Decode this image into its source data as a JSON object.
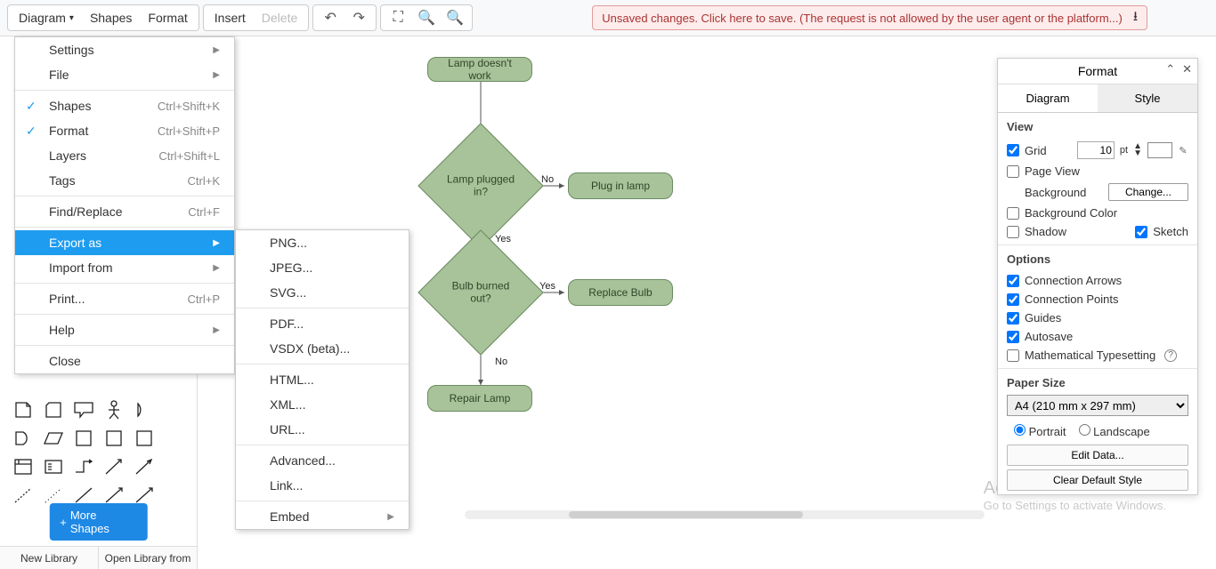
{
  "toolbar": {
    "diagram": "Diagram",
    "shapes": "Shapes",
    "format": "Format",
    "insert": "Insert",
    "delete": "Delete"
  },
  "warning": "Unsaved changes. Click here to save. (The request is not allowed by the user agent or the platform...)",
  "menu": {
    "settings": "Settings",
    "file": "File",
    "shapes": "Shapes",
    "shapes_sc": "Ctrl+Shift+K",
    "format": "Format",
    "format_sc": "Ctrl+Shift+P",
    "layers": "Layers",
    "layers_sc": "Ctrl+Shift+L",
    "tags": "Tags",
    "tags_sc": "Ctrl+K",
    "find": "Find/Replace",
    "find_sc": "Ctrl+F",
    "export": "Export as",
    "import": "Import from",
    "print": "Print...",
    "print_sc": "Ctrl+P",
    "help": "Help",
    "close": "Close"
  },
  "submenu": {
    "png": "PNG...",
    "jpeg": "JPEG...",
    "svg": "SVG...",
    "pdf": "PDF...",
    "vsdx": "VSDX (beta)...",
    "html": "HTML...",
    "xml": "XML...",
    "url": "URL...",
    "advanced": "Advanced...",
    "link": "Link...",
    "embed": "Embed"
  },
  "flow": {
    "n1": "Lamp doesn't work",
    "n2": "Lamp plugged in?",
    "n3": "Plug in lamp",
    "n4": "Bulb burned out?",
    "n5": "Replace Bulb",
    "n6": "Repair Lamp",
    "yes": "Yes",
    "no": "No"
  },
  "shapes_panel": {
    "more": "More Shapes"
  },
  "bottom": {
    "new_lib": "New Library",
    "open_lib": "Open Library from"
  },
  "fp": {
    "title": "Format",
    "tab_diagram": "Diagram",
    "tab_style": "Style",
    "view": "View",
    "grid": "Grid",
    "grid_val": "10",
    "grid_unit": "pt",
    "page_view": "Page View",
    "background": "Background",
    "change": "Change...",
    "bg_color": "Background Color",
    "shadow": "Shadow",
    "sketch": "Sketch",
    "options": "Options",
    "conn_arrows": "Connection Arrows",
    "conn_points": "Connection Points",
    "guides": "Guides",
    "autosave": "Autosave",
    "math": "Mathematical Typesetting",
    "paper": "Paper Size",
    "paper_val": "A4 (210 mm x 297 mm)",
    "portrait": "Portrait",
    "landscape": "Landscape",
    "edit_data": "Edit Data...",
    "clear_style": "Clear Default Style"
  },
  "watermark": {
    "t1": "Activate Windows",
    "t2": "Go to Settings to activate Windows."
  }
}
